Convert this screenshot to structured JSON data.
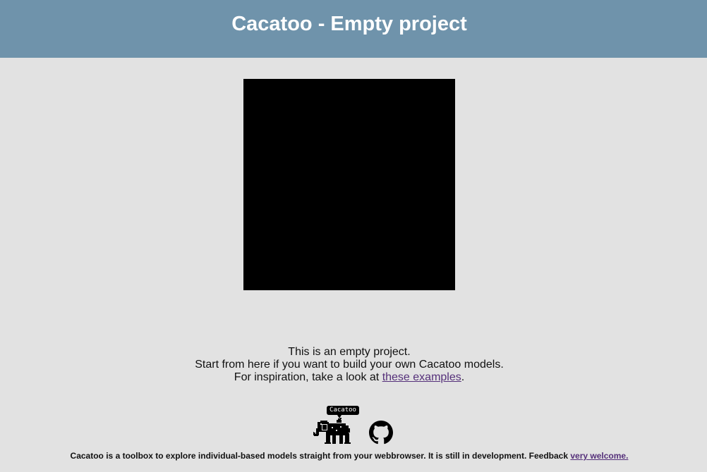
{
  "header": {
    "title": "Cacatoo - Empty project"
  },
  "description": {
    "line1": "This is an empty project.",
    "line2": "Start from here if you want to build your own Cacatoo models.",
    "line3_prefix": "For inspiration, take a look at ",
    "line3_link": "these examples",
    "line3_suffix": "."
  },
  "logo": {
    "bubble_text": "Cacatoo",
    "icon": "elephant-icon"
  },
  "github": {
    "icon": "github-icon"
  },
  "footer": {
    "text": "Cacatoo is a toolbox to explore individual-based models straight from your webbrowser. It is still in development. Feedback ",
    "link": "very welcome."
  },
  "colors": {
    "header_bg": "#6f93ab",
    "page_bg": "#e2e2e2",
    "canvas_bg": "#000000",
    "link": "#55307a"
  }
}
